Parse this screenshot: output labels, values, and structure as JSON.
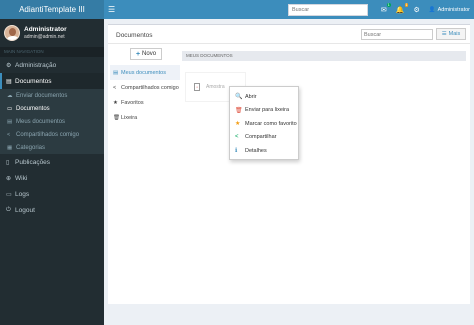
{
  "header": {
    "brand": "AdiantiTemplate III",
    "search_placeholder": "Buscar",
    "user_label": "Administrator",
    "badge_messages": "1",
    "badge_notifications": "1"
  },
  "sidebar": {
    "user": {
      "name": "Administrator",
      "email": "admin@admin.net"
    },
    "nav_header": "MAIN NAVIGATION",
    "items": [
      {
        "label": "Administração",
        "icon": "gear-icon"
      },
      {
        "label": "Documentos",
        "icon": "folder-icon"
      }
    ],
    "documentos_sub": [
      {
        "label": "Enviar documentos"
      },
      {
        "label": "Documentos"
      }
    ],
    "documentos_sub2": [
      {
        "label": "Meus documentos"
      },
      {
        "label": "Compartilhados comigo"
      },
      {
        "label": "Categorias"
      }
    ],
    "items_after": [
      {
        "label": "Publicações"
      },
      {
        "label": "Wiki"
      },
      {
        "label": "Logs"
      },
      {
        "label": "Logout"
      }
    ]
  },
  "content": {
    "title": "Documentos",
    "search_placeholder": "Buscar",
    "mais_label": "Mais",
    "novo_label": "Novo",
    "left_nav": [
      {
        "label": "Meus documentos"
      },
      {
        "label": "Compartilhados comigo"
      },
      {
        "label": "Favoritos"
      },
      {
        "label": "Lixeira"
      }
    ],
    "files_header": "MEUS DOCUMENTOS",
    "file": {
      "name": "Amostra"
    },
    "context_menu": [
      {
        "label": "Abrir"
      },
      {
        "label": "Enviar para lixeira"
      },
      {
        "label": "Marcar como favorito"
      },
      {
        "label": "Compartilhar"
      },
      {
        "label": "Detalhes"
      }
    ]
  },
  "colors": {
    "header_brand": "#357ca5",
    "header_bar": "#3c8dbc",
    "sidebar": "#222d32",
    "active_accent": "#3c8dbc"
  }
}
